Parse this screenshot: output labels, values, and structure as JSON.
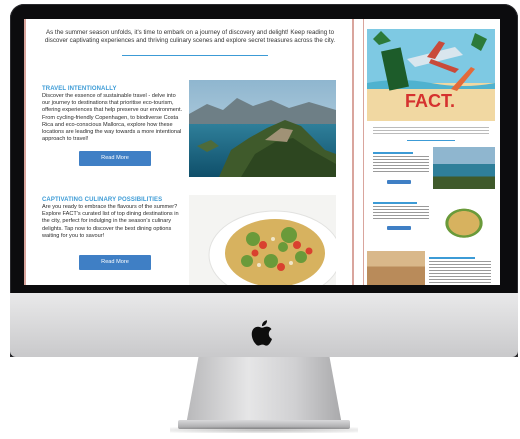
{
  "newsletter": {
    "intro": "As the summer season unfolds, it's time to embark on a journey of discovery and delight! Keep reading to discover captivating experiences and thriving culinary scenes and explore secret treasures across the city.",
    "sections": [
      {
        "title": "TRAVEL INTENTIONALLY",
        "body": "Discover the essence of sustainable travel - delve into our journey to destinations that prioritise eco-tourism, offering experiences that help preserve our environment. From cycling-friendly Copenhagen, to biodiverse Costa Rica and eco-conscious Mallorca, explore how these locations are leading the way towards a more intentional approach to travel!",
        "button": "Read More",
        "image_icon": "coastal-landscape-photo"
      },
      {
        "title": "CAPTIVATING CULINARY POSSIBILITIES",
        "body": "Are you ready to embrace the flavours of the summer? Explore FACT's curated list of top dining destinations in the city, perfect for indulging in the season's culinary delights. Tap now to discover the best dining options waiting for you to savour!",
        "button": "Read More",
        "image_icon": "pasta-salad-photo"
      }
    ]
  },
  "mini": {
    "hero_logo": "FACT.",
    "colors": {
      "accent": "#3c9bd6",
      "button": "#3f7fc5",
      "frame": "#d9a59d"
    }
  }
}
